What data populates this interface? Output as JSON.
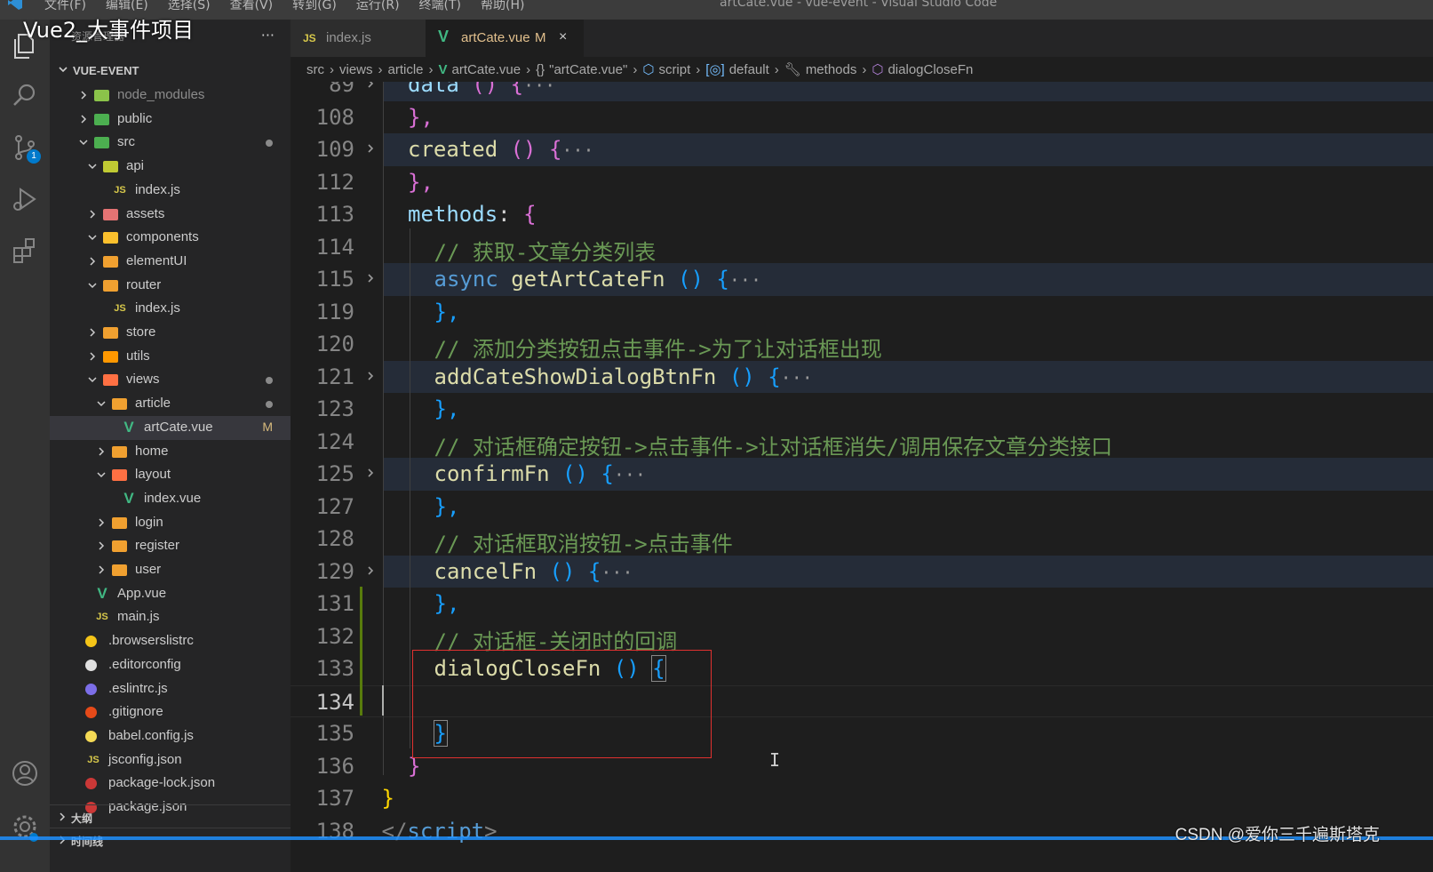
{
  "overlay_title": "Vue2_大事件项目",
  "menubar": {
    "items": [
      "文件(F)",
      "编辑(E)",
      "选择(S)",
      "查看(V)",
      "转到(G)",
      "运行(R)",
      "终端(T)",
      "帮助(H)"
    ],
    "window_title": "artCate.vue - vue-event - Visual Studio Code"
  },
  "activitybar": {
    "source_control_badge": "1"
  },
  "sidebar": {
    "header": "资源管理器",
    "more": "···",
    "root": "VUE-EVENT",
    "tree": [
      {
        "label": "node_modules",
        "icon": "folder-node-icon",
        "icon_color": "#8bc34a",
        "dim": true
      },
      {
        "label": "public",
        "icon": "folder-public-icon",
        "icon_color": "#4caf50"
      },
      {
        "label": "src",
        "icon": "folder-src-icon",
        "icon_color": "#4caf50",
        "dot": true
      },
      {
        "label": "api",
        "icon": "folder-api-icon",
        "icon_color": "#c0ca33"
      },
      {
        "label": "index.js",
        "icon": "js-file-icon",
        "glyph": "JS"
      },
      {
        "label": "assets",
        "icon": "folder-assets-icon",
        "icon_color": "#e57373"
      },
      {
        "label": "components",
        "icon": "folder-components-icon",
        "icon_color": "#fbc02d"
      },
      {
        "label": "elementUI",
        "icon": "folder-icon",
        "icon_color": "#f0a030"
      },
      {
        "label": "router",
        "icon": "folder-router-icon",
        "icon_color": "#f0a030"
      },
      {
        "label": "index.js",
        "icon": "js-file-icon",
        "glyph": "JS"
      },
      {
        "label": "store",
        "icon": "folder-icon",
        "icon_color": "#f0a030"
      },
      {
        "label": "utils",
        "icon": "folder-utils-icon",
        "icon_color": "#ff9800"
      },
      {
        "label": "views",
        "icon": "folder-views-icon",
        "icon_color": "#ff7043",
        "dot": true
      },
      {
        "label": "article",
        "icon": "folder-icon",
        "icon_color": "#f0a030",
        "dot": true
      },
      {
        "label": "artCate.vue",
        "icon": "vue-file-icon",
        "glyph": "V",
        "modified": "M"
      },
      {
        "label": "home",
        "icon": "folder-icon",
        "icon_color": "#f0a030"
      },
      {
        "label": "layout",
        "icon": "folder-layout-icon",
        "icon_color": "#ff7043"
      },
      {
        "label": "index.vue",
        "icon": "vue-file-icon",
        "glyph": "V"
      },
      {
        "label": "login",
        "icon": "folder-icon",
        "icon_color": "#f0a030"
      },
      {
        "label": "register",
        "icon": "folder-icon",
        "icon_color": "#f0a030"
      },
      {
        "label": "user",
        "icon": "folder-icon",
        "icon_color": "#f0a030"
      },
      {
        "label": "App.vue",
        "icon": "vue-file-icon",
        "glyph": "V"
      },
      {
        "label": "main.js",
        "icon": "js-file-icon",
        "glyph": "JS"
      },
      {
        "label": ".browserslistrc",
        "icon": "browserslist-icon",
        "icon_color": "#f5c518"
      },
      {
        "label": ".editorconfig",
        "icon": "editorconfig-icon",
        "icon_color": "#e0e0e0"
      },
      {
        "label": ".eslintrc.js",
        "icon": "eslint-icon",
        "icon_color": "#7c6ee8"
      },
      {
        "label": ".gitignore",
        "icon": "git-icon",
        "icon_color": "#e64a19"
      },
      {
        "label": "babel.config.js",
        "icon": "babel-icon",
        "icon_color": "#f5da55"
      },
      {
        "label": "jsconfig.json",
        "icon": "js-file-icon",
        "glyph": "JS"
      },
      {
        "label": "package-lock.json",
        "icon": "npm-icon",
        "icon_color": "#cb3837"
      },
      {
        "label": "package.json",
        "icon": "npm-icon",
        "icon_color": "#cb3837"
      }
    ],
    "outline_label": "大纲",
    "timeline_label": "时间线"
  },
  "tabs": [
    {
      "label": "index.js",
      "glyph": "JS",
      "active": false
    },
    {
      "label": "artCate.vue",
      "glyph": "V",
      "modified": "M",
      "close": "×",
      "active": true
    }
  ],
  "breadcrumbs": [
    "src",
    "views",
    "article",
    "artCate.vue",
    "\"artCate.vue\"",
    "script",
    "default",
    "methods",
    "dialogCloseFn"
  ],
  "editor": {
    "lines": [
      {
        "n": "89",
        "fold": true
      },
      {
        "n": "108"
      },
      {
        "n": "109",
        "fold": true
      },
      {
        "n": "112"
      },
      {
        "n": "113"
      },
      {
        "n": "114"
      },
      {
        "n": "115",
        "fold": true
      },
      {
        "n": "119"
      },
      {
        "n": "120"
      },
      {
        "n": "121",
        "fold": true
      },
      {
        "n": "123"
      },
      {
        "n": "124"
      },
      {
        "n": "125",
        "fold": true
      },
      {
        "n": "127"
      },
      {
        "n": "128"
      },
      {
        "n": "129",
        "fold": true
      },
      {
        "n": "131"
      },
      {
        "n": "132"
      },
      {
        "n": "133"
      },
      {
        "n": "134",
        "current": true
      },
      {
        "n": "135"
      },
      {
        "n": "136"
      },
      {
        "n": "137"
      },
      {
        "n": "138"
      }
    ],
    "tokens": {
      "data_kw": "data",
      "created_kw": "created",
      "methods_kw": "methods",
      "colon": ":",
      "comment_114": "// 获取-文章分类列表",
      "async_kw": "async",
      "fn_getArtCate": "getArtCateFn",
      "comment_120": "// 添加分类按钮点击事件->为了让对话框出现",
      "fn_addCate": "addCateShowDialogBtnFn",
      "comment_124": "// 对话框确定按钮->点击事件->让对话框消失/调用保存文章分类接口",
      "fn_confirm": "confirmFn",
      "comment_128": "// 对话框取消按钮->点击事件",
      "fn_cancel": "cancelFn",
      "comment_132": "// 对话框-关闭时的回调",
      "fn_dialogClose": "dialogCloseFn",
      "parens": "()",
      "brace_open": "{",
      "brace_close": "}",
      "brace_close_comma": "},",
      "fold_ellipsis": "···",
      "script_close_lt": "</",
      "script_close_name": "script",
      "script_close_gt": ">"
    }
  },
  "watermark": "CSDN @爱你三千遍斯塔克",
  "colors": {
    "accent": "#007acc",
    "highlight_box": "#e0312f",
    "comment": "#6a9955",
    "function": "#dcdcaa",
    "keyword": "#569cd6",
    "property": "#9cdcfe"
  }
}
